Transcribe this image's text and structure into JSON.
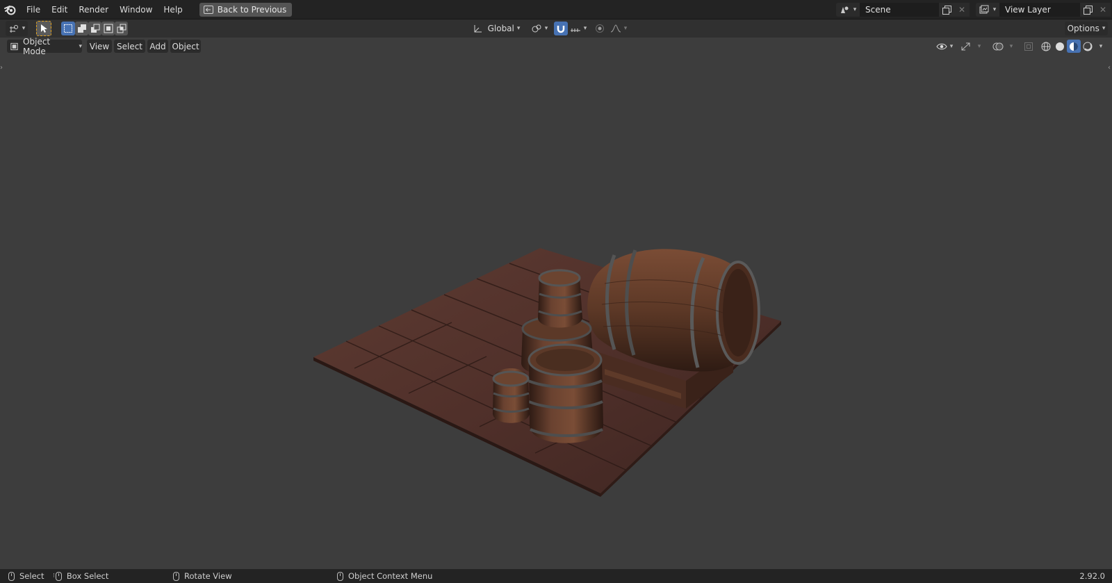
{
  "topbar": {
    "menu": [
      "File",
      "Edit",
      "Render",
      "Window",
      "Help"
    ],
    "back_button": "Back to Previous",
    "scene": "Scene",
    "view_layer": "View Layer"
  },
  "toolbar": {
    "orientation": "Global",
    "options": "Options"
  },
  "header": {
    "mode": "Object Mode",
    "menus": [
      "View",
      "Select",
      "Add",
      "Object"
    ]
  },
  "status": {
    "select": "Select",
    "box_select": "Box Select",
    "rotate_view": "Rotate View",
    "context_menu": "Object Context Menu",
    "version": "2.92.0"
  },
  "colors": {
    "accent": "#4772b3",
    "active_tool": "#e5a31a",
    "background": "#3d3d3d"
  }
}
